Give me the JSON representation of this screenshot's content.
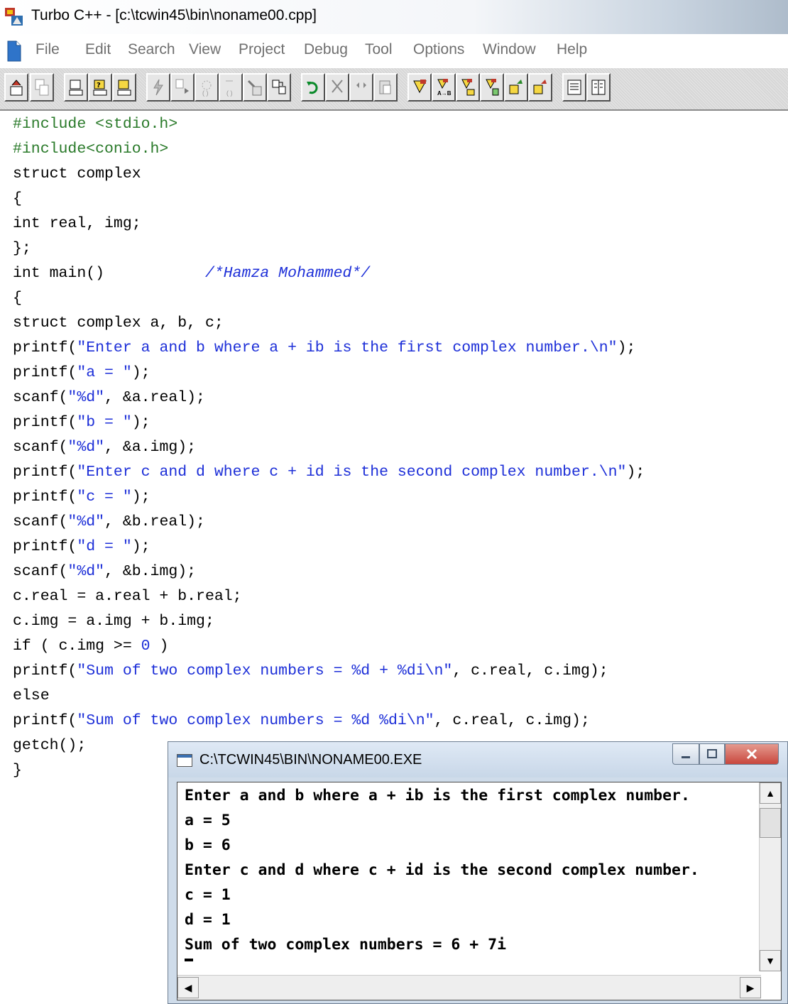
{
  "window": {
    "title": "Turbo C++ - [c:\\tcwin45\\bin\\noname00.cpp]"
  },
  "menu": [
    "File",
    "Edit",
    "Search",
    "View",
    "Project",
    "Debug",
    "Tool",
    "Options",
    "Window",
    "Help"
  ],
  "editor": {
    "lines": [
      [
        {
          "t": "pre",
          "v": "#include <stdio.h>"
        }
      ],
      [
        {
          "t": "pre",
          "v": "#include<conio.h>"
        }
      ],
      [
        {
          "t": "plain",
          "v": "struct complex"
        }
      ],
      [
        {
          "t": "plain",
          "v": "{"
        }
      ],
      [
        {
          "t": "plain",
          "v": "int real, img;"
        }
      ],
      [
        {
          "t": "plain",
          "v": "};"
        }
      ],
      [
        {
          "t": "plain",
          "v": "int main()           "
        },
        {
          "t": "cmt",
          "v": "/*Hamza Mohammed*/"
        }
      ],
      [
        {
          "t": "plain",
          "v": "{"
        }
      ],
      [
        {
          "t": "plain",
          "v": "struct complex a, b, c;"
        }
      ],
      [
        {
          "t": "plain",
          "v": "printf("
        },
        {
          "t": "str",
          "v": "\"Enter a and b where a + ib is the first complex number.\\n\""
        },
        {
          "t": "plain",
          "v": ");"
        }
      ],
      [
        {
          "t": "plain",
          "v": "printf("
        },
        {
          "t": "str",
          "v": "\"a = \""
        },
        {
          "t": "plain",
          "v": ");"
        }
      ],
      [
        {
          "t": "plain",
          "v": "scanf("
        },
        {
          "t": "str",
          "v": "\"%d\""
        },
        {
          "t": "plain",
          "v": ", &a.real);"
        }
      ],
      [
        {
          "t": "plain",
          "v": "printf("
        },
        {
          "t": "str",
          "v": "\"b = \""
        },
        {
          "t": "plain",
          "v": ");"
        }
      ],
      [
        {
          "t": "plain",
          "v": "scanf("
        },
        {
          "t": "str",
          "v": "\"%d\""
        },
        {
          "t": "plain",
          "v": ", &a.img);"
        }
      ],
      [
        {
          "t": "plain",
          "v": "printf("
        },
        {
          "t": "str",
          "v": "\"Enter c and d where c + id is the second complex number.\\n\""
        },
        {
          "t": "plain",
          "v": ");"
        }
      ],
      [
        {
          "t": "plain",
          "v": "printf("
        },
        {
          "t": "str",
          "v": "\"c = \""
        },
        {
          "t": "plain",
          "v": ");"
        }
      ],
      [
        {
          "t": "plain",
          "v": "scanf("
        },
        {
          "t": "str",
          "v": "\"%d\""
        },
        {
          "t": "plain",
          "v": ", &b.real);"
        }
      ],
      [
        {
          "t": "plain",
          "v": "printf("
        },
        {
          "t": "str",
          "v": "\"d = \""
        },
        {
          "t": "plain",
          "v": ");"
        }
      ],
      [
        {
          "t": "plain",
          "v": "scanf("
        },
        {
          "t": "str",
          "v": "\"%d\""
        },
        {
          "t": "plain",
          "v": ", &b.img);"
        }
      ],
      [
        {
          "t": "plain",
          "v": "c.real = a.real + b.real;"
        }
      ],
      [
        {
          "t": "plain",
          "v": "c.img = a.img + b.img;"
        }
      ],
      [
        {
          "t": "plain",
          "v": "if ( c.img >= "
        },
        {
          "t": "num",
          "v": "0"
        },
        {
          "t": "plain",
          "v": " )"
        }
      ],
      [
        {
          "t": "plain",
          "v": "printf("
        },
        {
          "t": "str",
          "v": "\"Sum of two complex numbers = %d + %di\\n\""
        },
        {
          "t": "plain",
          "v": ", c.real, c.img);"
        }
      ],
      [
        {
          "t": "plain",
          "v": "else"
        }
      ],
      [
        {
          "t": "plain",
          "v": "printf("
        },
        {
          "t": "str",
          "v": "\"Sum of two complex numbers = %d %di\\n\""
        },
        {
          "t": "plain",
          "v": ", c.real, c.img);"
        }
      ],
      [
        {
          "t": "plain",
          "v": "getch();"
        }
      ],
      [
        {
          "t": "plain",
          "v": "}"
        }
      ]
    ]
  },
  "console": {
    "title": "C:\\TCWIN45\\BIN\\NONAME00.EXE",
    "lines": [
      "Enter a and b where a + ib is the first complex number.",
      "a = 5",
      "b = 6",
      "Enter c and d where c + id is the second complex number.",
      "c = 1",
      "d = 1",
      "Sum of two complex numbers = 6 + 7i"
    ]
  },
  "colors": {
    "preprocessor": "#2a7a2a",
    "string": "#1d2fd8",
    "comment": "#1d2fd8",
    "close_button": "#c9463d"
  },
  "toolbar_icons": [
    "new-file-icon",
    "save-icon",
    "compile-icon",
    "make-icon",
    "build-icon",
    "run-icon",
    "step-over-icon",
    "trace-into-icon",
    "breakpoint-icon",
    "project-icon",
    "undo-icon",
    "cut-icon",
    "copy-icon",
    "paste-icon",
    "find-icon",
    "replace-icon",
    "search-again-icon",
    "browse-icon",
    "add-item-icon",
    "delete-item-icon",
    "window-icon",
    "tile-icon"
  ]
}
